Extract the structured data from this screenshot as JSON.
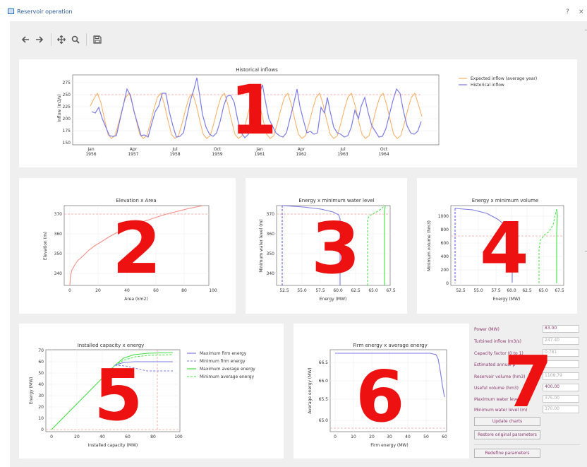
{
  "window": {
    "title": "Reservoir operation",
    "help": "?",
    "close": "×"
  },
  "toolbar": {
    "back_icon": "arrow-left",
    "forward_icon": "arrow-right",
    "pan_icon": "move-arrows",
    "zoom_icon": "magnifier",
    "save_icon": "floppy-disk"
  },
  "overlay_numbers": [
    "1",
    "2",
    "3",
    "4",
    "5",
    "6",
    "7"
  ],
  "colors": {
    "orange": "#f6b26b",
    "blue": "#7b7be6",
    "green": "#40e040",
    "dashed_red": "#f3a39a",
    "line_red": "#f48f86",
    "number_red": "#ee1111"
  },
  "charts": {
    "historical": {
      "title": "Historical inflows",
      "ylabel": "Inflow (m3/s)",
      "yticks": [
        "275",
        "250",
        "225",
        "200",
        "175",
        "150"
      ],
      "xticks": [
        [
          "Jan",
          "1956"
        ],
        [
          "Apr",
          "1957"
        ],
        [
          "Jul",
          "1958"
        ],
        [
          "Oct",
          "1959"
        ],
        [
          "Jan",
          "1961"
        ],
        [
          "Apr",
          "1962"
        ],
        [
          "Jul",
          "1963"
        ],
        [
          "Oct",
          "1964"
        ]
      ],
      "legend": [
        "Expected inflow (average year)",
        "Historical inflow"
      ]
    },
    "elev_area": {
      "title": "Elevation x Area",
      "xlabel": "Area (km2)",
      "ylabel": "Elevation (m)",
      "xticks": [
        "0",
        "20",
        "40",
        "60",
        "80",
        "100"
      ],
      "yticks": [
        "370",
        "360",
        "350",
        "340"
      ]
    },
    "energy_level": {
      "title": "Energy x minimum water level",
      "xlabel": "Energy (MW)",
      "ylabel": "Minimum water level (m)",
      "xticks": [
        "52.5",
        "55.0",
        "57.5",
        "60.0",
        "62.5",
        "65.0",
        "67.5"
      ],
      "yticks": [
        "370",
        "360",
        "350",
        "340"
      ]
    },
    "energy_volume": {
      "title": "Energy x minimum volume",
      "xlabel": "Energy (MW)",
      "ylabel": "Minimum volume (hm3)",
      "xticks": [
        "52.5",
        "55.0",
        "57.5",
        "60.0",
        "62.5",
        "65.0",
        "67.5"
      ],
      "yticks": [
        "1000",
        "800",
        "600",
        "400",
        "200",
        "0"
      ]
    },
    "capacity": {
      "title": "Installed capacity x energy",
      "xlabel": "Installed capacity (MW)",
      "ylabel": "Energy (MW)",
      "xticks": [
        "0",
        "20",
        "40",
        "60",
        "80",
        "100"
      ],
      "yticks": [
        "70",
        "60",
        "50",
        "40",
        "30",
        "20",
        "10",
        "0"
      ],
      "legend": [
        "Maximum firm energy",
        "Minimum firm energy",
        "Maximum average energy",
        "Minimum average energy"
      ]
    },
    "firm_avg": {
      "title": "Firm energy x average energy",
      "xlabel": "Firm energy (MW)",
      "ylabel": "Average energy (MW)",
      "xticks": [
        "0",
        "10",
        "20",
        "30",
        "40",
        "50",
        "60"
      ],
      "yticks": [
        "66.5",
        "66.0",
        "65.5",
        "65.0"
      ]
    }
  },
  "form": {
    "fields": [
      {
        "label": "Power (MW)",
        "value": "83.00",
        "editable": true
      },
      {
        "label": "Turbined inflow (m3/s)",
        "value": "247.40",
        "editable": false
      },
      {
        "label": "Capacity factor (0 to 1)",
        "value": "0.781",
        "editable": false
      },
      {
        "label": "Estimated annual p",
        "value": "",
        "editable": false
      },
      {
        "label": "Reservoir volume (hm3)",
        "value": "1108.79",
        "editable": false
      },
      {
        "label": "Useful volume (hm3)",
        "value": "400.00",
        "editable": true
      },
      {
        "label": "Maximum water level",
        "value": "375.00",
        "editable": false
      },
      {
        "label": "Minimum water level (m)",
        "value": "370.00",
        "editable": false
      }
    ],
    "update_button": "Update charts",
    "restore_button": "Restore original parameters",
    "redefine_button": "Redefine parameters"
  }
}
